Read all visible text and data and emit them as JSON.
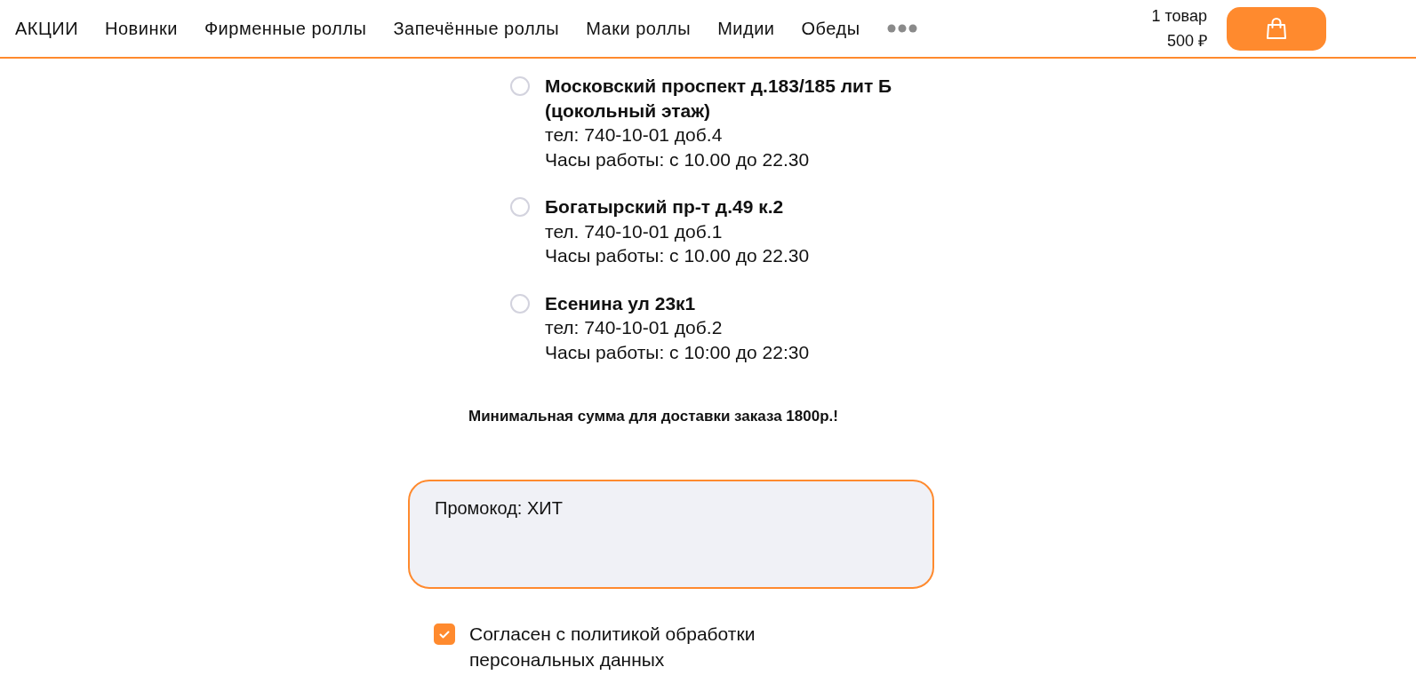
{
  "nav": {
    "items": [
      {
        "label": "АКЦИИ"
      },
      {
        "label": "Новинки"
      },
      {
        "label": "Фирменные роллы"
      },
      {
        "label": "Запечённые роллы"
      },
      {
        "label": "Маки роллы"
      },
      {
        "label": "Мидии"
      },
      {
        "label": "Обеды"
      }
    ]
  },
  "cart": {
    "count": "1 товар",
    "total": "500 ₽"
  },
  "stores": [
    {
      "name": "Московский проспект д.183/185 лит Б (цокольный этаж)",
      "phone": "тел: 740-10-01 доб.4",
      "hours": "Часы работы: с 10.00 до 22.30",
      "selected": false
    },
    {
      "name": "Богатырский пр-т д.49 к.2",
      "phone": "тел. 740-10-01 доб.1",
      "hours": "Часы работы: с 10.00 до 22.30",
      "selected": false
    },
    {
      "name": "Есенина ул 23к1",
      "phone": "тел: 740-10-01 доб.2",
      "hours": "Часы работы: с 10:00 до 22:30",
      "selected": false
    }
  ],
  "min_order_note": "Минимальная сумма для доставки заказа 1800р.!",
  "promo": {
    "value": "Промокод: ХИТ"
  },
  "consent": {
    "label": "Согласен с политикой обработки персональных данных",
    "checked": true
  }
}
